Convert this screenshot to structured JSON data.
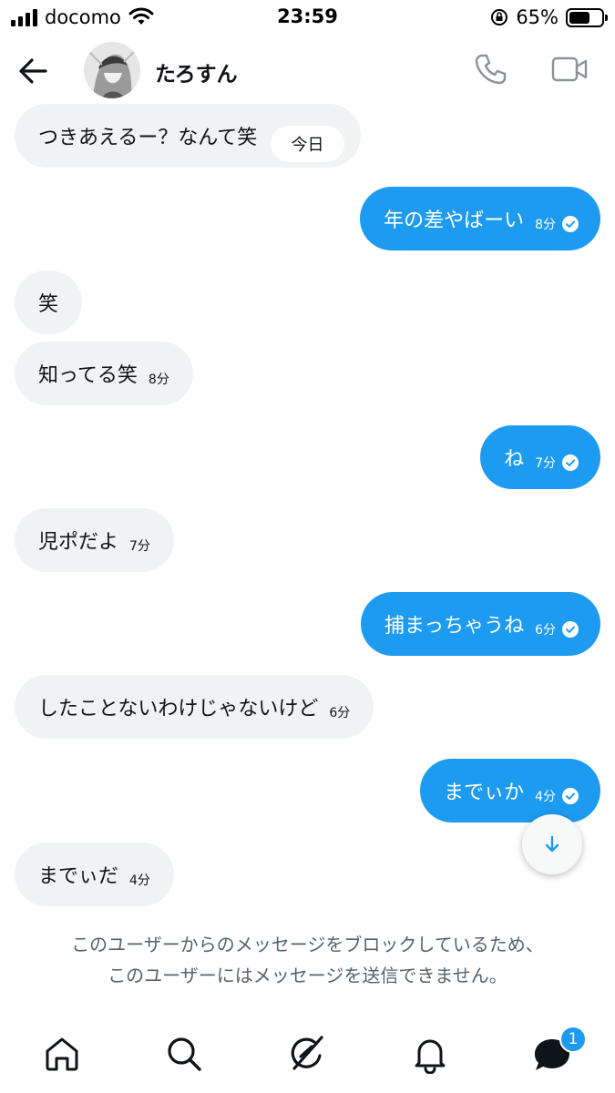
{
  "status_bar": {
    "carrier": "docomo",
    "time": "23:59",
    "battery": "65%",
    "battery_level": 0.65
  },
  "header": {
    "name": "たろすん",
    "back_icon": "back-arrow-icon",
    "call_icon": "phone-icon",
    "video_icon": "video-camera-icon"
  },
  "day_separator": "今日",
  "messages": [
    {
      "side": "received",
      "text": "つきあえるー？なんて笑",
      "time": ""
    },
    {
      "side": "sent",
      "text": "年の差やばーい",
      "time": "8分"
    },
    {
      "side": "received",
      "text": "笑",
      "time": ""
    },
    {
      "side": "received",
      "text": "知ってる笑",
      "time": "8分"
    },
    {
      "side": "sent",
      "text": "ね",
      "time": "7分"
    },
    {
      "side": "received",
      "text": "児ポだよ",
      "time": "7分"
    },
    {
      "side": "sent",
      "text": "捕まっちゃうね",
      "time": "6分"
    },
    {
      "side": "received",
      "text": "したことないわけじゃないけど",
      "time": "6分"
    },
    {
      "side": "sent",
      "text": "までぃか",
      "time": "4分"
    },
    {
      "side": "received",
      "text": "までぃだ",
      "time": "4分"
    }
  ],
  "blocked_notice": {
    "line1": "このユーザーからのメッセージをブロックしているため、",
    "line2": "このユーザーにはメッセージを送信できません。"
  },
  "bottom_nav": {
    "items": [
      "home-icon",
      "search-icon",
      "grok-icon",
      "notifications-bell-icon",
      "messages-icon"
    ],
    "messages_badge": "1"
  },
  "colors": {
    "accent": "#1d9bf0",
    "received_bubble": "#eff3f4",
    "muted_text": "#536471"
  }
}
